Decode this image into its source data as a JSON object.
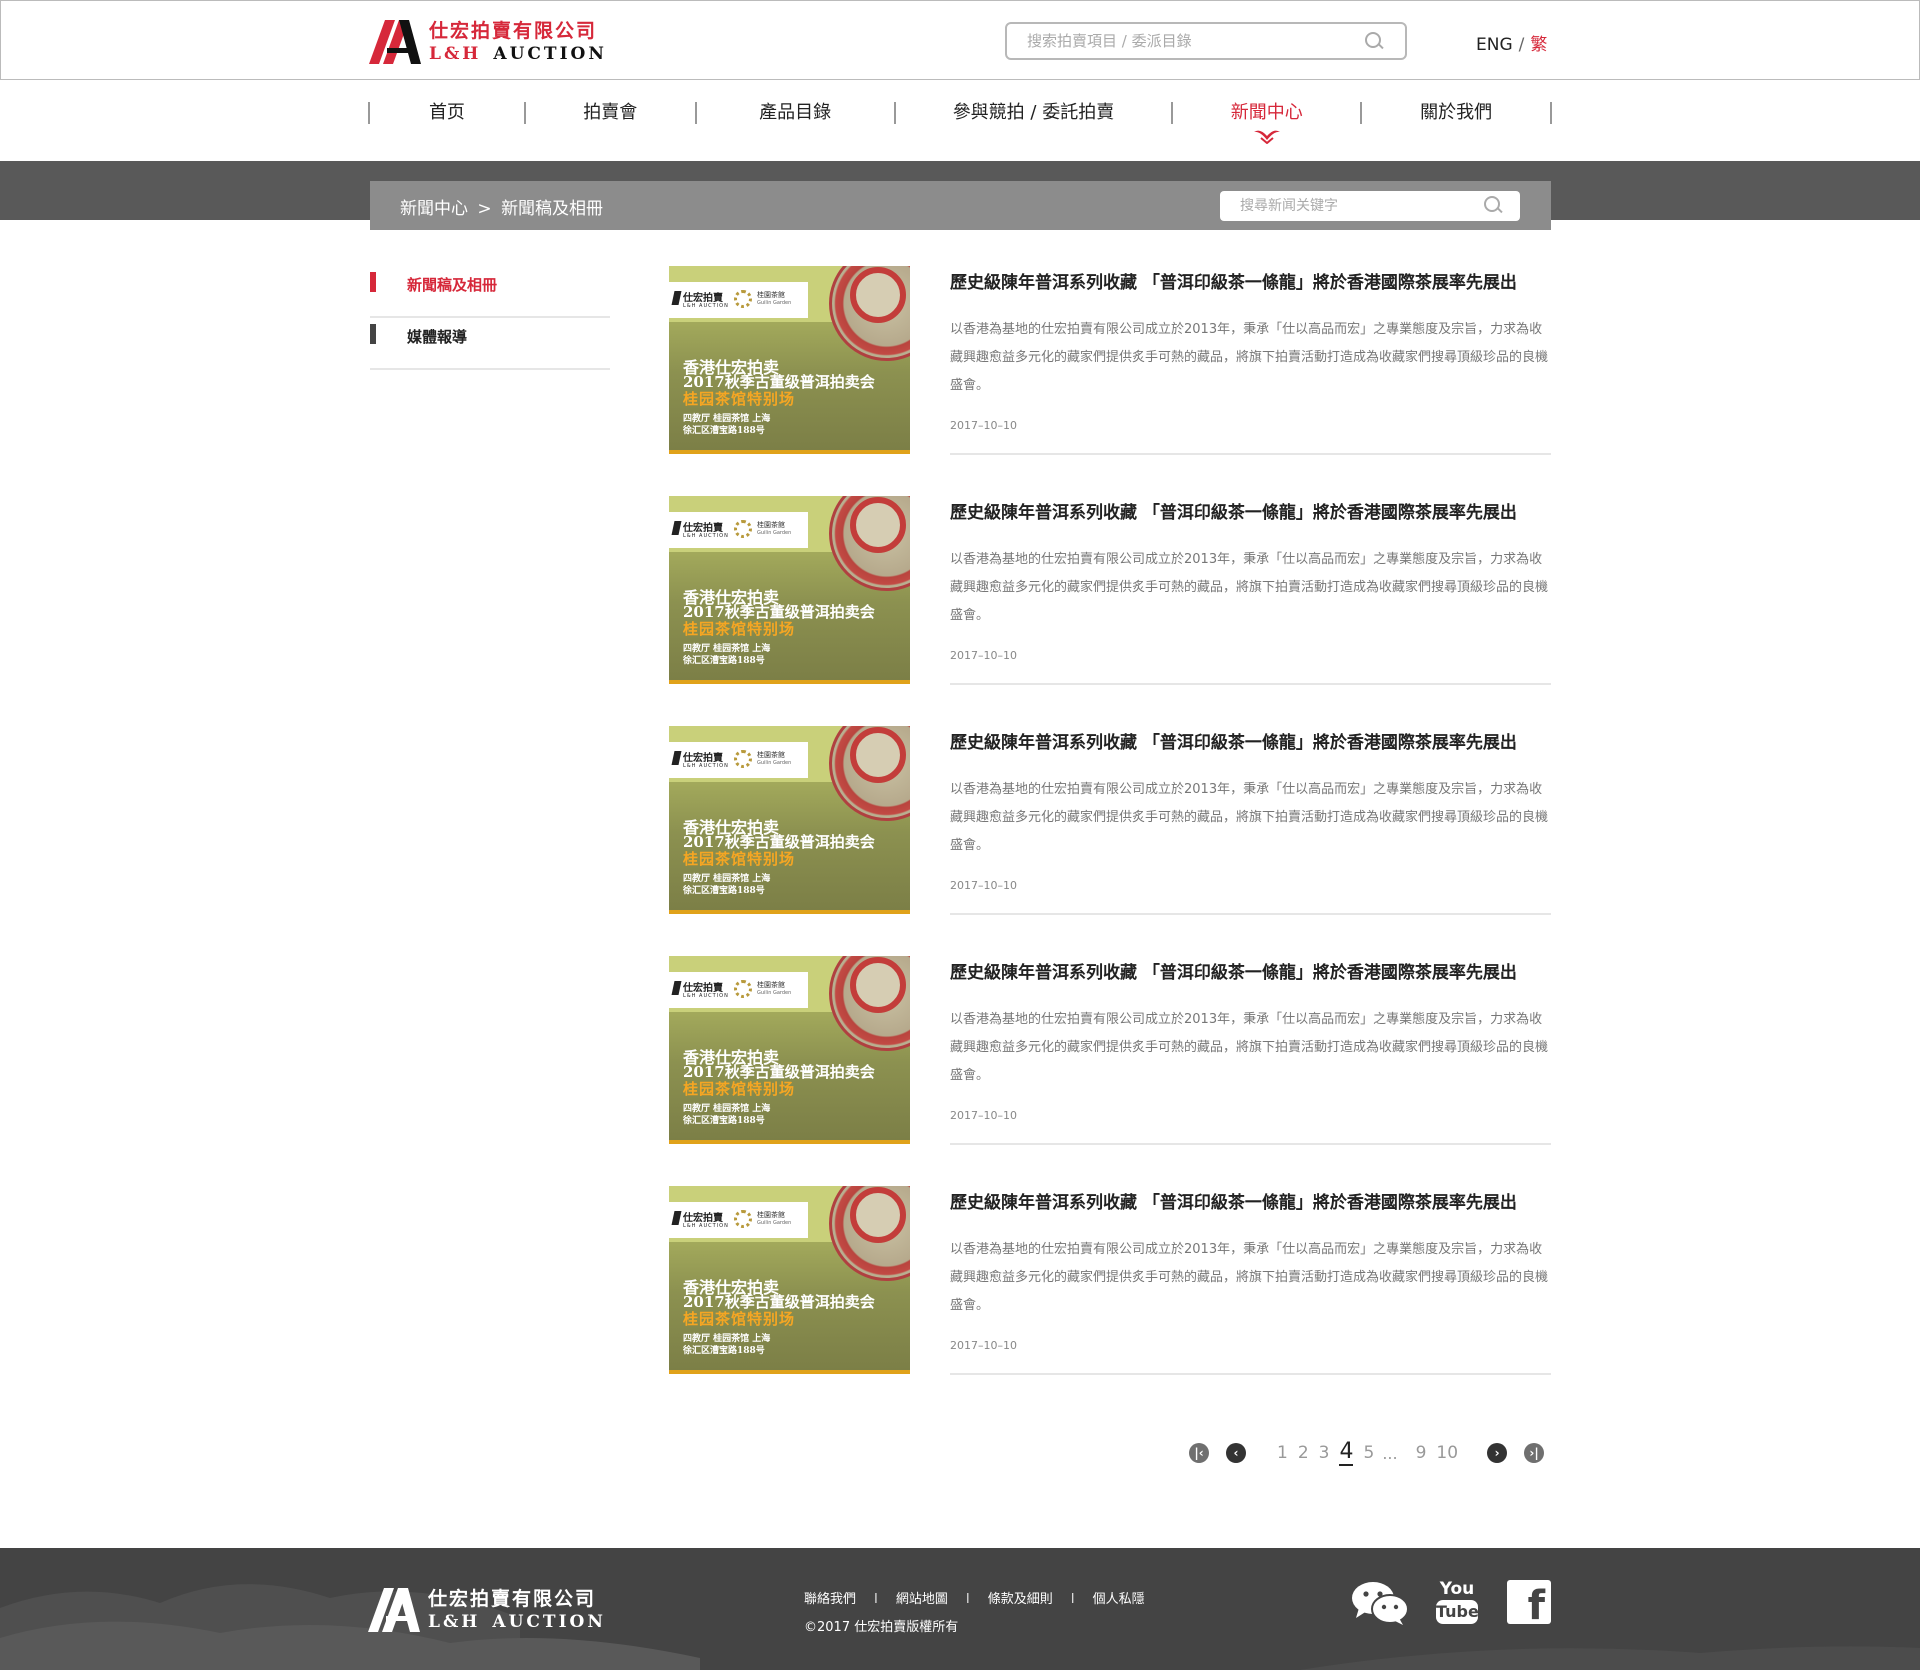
{
  "brand": {
    "name_cn": "仕宏拍賣有限公司",
    "name_en_1": "L&H",
    "name_en_2": "AUCTION",
    "accent_color": "#d6283a"
  },
  "header": {
    "search_placeholder": "搜索拍賣項目 / 委派目錄",
    "lang_en": "ENG",
    "lang_sep": "/",
    "lang_trad": "繁"
  },
  "nav": {
    "items": [
      {
        "label": "首页"
      },
      {
        "label": "拍賣會"
      },
      {
        "label": "產品目錄"
      },
      {
        "label": "參與競拍 / 委託拍賣"
      },
      {
        "label": "新聞中心",
        "active": true
      },
      {
        "label": "關於我們"
      }
    ]
  },
  "breadcrumb": {
    "parent": "新聞中心",
    "separator": ">",
    "current": "新聞稿及相冊",
    "search_placeholder": "搜尋新闻关键字"
  },
  "sidebar": {
    "items": [
      {
        "label": "新聞稿及相冊",
        "active": true
      },
      {
        "label": "媒體報導"
      }
    ]
  },
  "thumbnail": {
    "logo_cn": "仕宏拍賣",
    "logo_en": "L&H AUCTION",
    "partner_cn": "桂園茶館",
    "partner_en": "Guilin Garden",
    "line1": "香港仕宏拍卖",
    "line2": "2017秋季古董级普洱拍卖会",
    "line3": "桂园茶馆特别场",
    "line4": "四教厅 桂园茶馆 上海",
    "line5": "徐汇区漕宝路188号"
  },
  "articles": [
    {
      "title": "歷史級陳年普洱系列收藏 「普洱印級茶一條龍」將於香港國際茶展率先展出",
      "body": "以香港為基地的仕宏拍賣有限公司成立於2013年，秉承「仕以高品而宏」之專業態度及宗旨，力求為收藏興趣愈益多元化的藏家們提供炙手可熱的藏品，將旗下拍賣活動打造成為收藏家們搜尋頂級珍品的良機盛會。",
      "date": "2017–10–10"
    },
    {
      "title": "歷史級陳年普洱系列收藏 「普洱印級茶一條龍」將於香港國際茶展率先展出",
      "body": "以香港為基地的仕宏拍賣有限公司成立於2013年，秉承「仕以高品而宏」之專業態度及宗旨，力求為收藏興趣愈益多元化的藏家們提供炙手可熱的藏品，將旗下拍賣活動打造成為收藏家們搜尋頂級珍品的良機盛會。",
      "date": "2017–10–10"
    },
    {
      "title": "歷史級陳年普洱系列收藏 「普洱印級茶一條龍」將於香港國際茶展率先展出",
      "body": "以香港為基地的仕宏拍賣有限公司成立於2013年，秉承「仕以高品而宏」之專業態度及宗旨，力求為收藏興趣愈益多元化的藏家們提供炙手可熱的藏品，將旗下拍賣活動打造成為收藏家們搜尋頂級珍品的良機盛會。",
      "date": "2017–10–10"
    },
    {
      "title": "歷史級陳年普洱系列收藏 「普洱印級茶一條龍」將於香港國際茶展率先展出",
      "body": "以香港為基地的仕宏拍賣有限公司成立於2013年，秉承「仕以高品而宏」之專業態度及宗旨，力求為收藏興趣愈益多元化的藏家們提供炙手可熱的藏品，將旗下拍賣活動打造成為收藏家們搜尋頂級珍品的良機盛會。",
      "date": "2017–10–10"
    },
    {
      "title": "歷史級陳年普洱系列收藏 「普洱印級茶一條龍」將於香港國際茶展率先展出",
      "body": "以香港為基地的仕宏拍賣有限公司成立於2013年，秉承「仕以高品而宏」之專業態度及宗旨，力求為收藏興趣愈益多元化的藏家們提供炙手可熱的藏品，將旗下拍賣活動打造成為收藏家們搜尋頂級珍品的良機盛會。",
      "date": "2017–10–10"
    }
  ],
  "pagination": {
    "pages_before": [
      "1",
      "2",
      "3"
    ],
    "current": "4",
    "pages_after": [
      "5"
    ],
    "ellipsis": "...",
    "pages_end": [
      "9",
      "10"
    ],
    "icons": [
      "first-page-icon",
      "prev-page-icon",
      "next-page-icon",
      "last-page-icon"
    ]
  },
  "footer": {
    "links": [
      "聯絡我們",
      "網站地圖",
      "條款及細則",
      "個人私隱"
    ],
    "link_sep": "I",
    "copyright": "©2017 仕宏拍賣版權所有",
    "youtube_you": "You",
    "youtube_tube": "Tube",
    "facebook_letter": "f",
    "icons": [
      "wechat-icon",
      "youtube-icon",
      "facebook-icon"
    ]
  }
}
